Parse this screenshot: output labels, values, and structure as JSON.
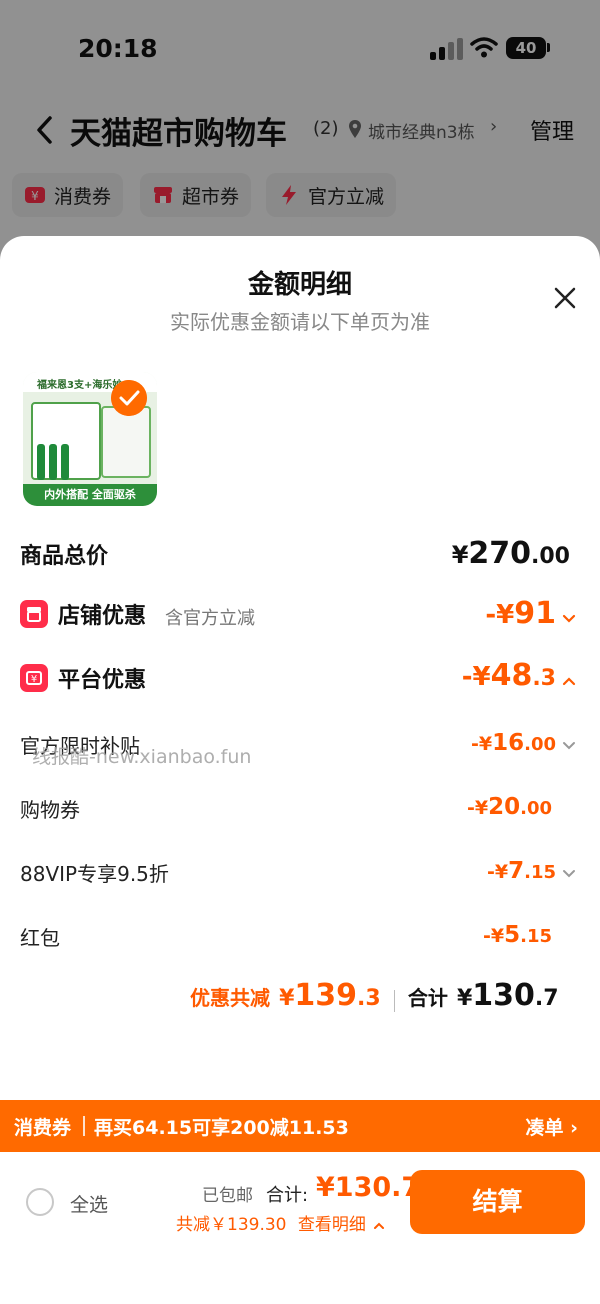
{
  "status_bar": {
    "time": "20:18",
    "battery": "40"
  },
  "header": {
    "title": "天猫超市购物车",
    "count": "(2)",
    "location": "城市经典n3栋",
    "location_arrow": "›",
    "manage": "管理"
  },
  "chips": [
    {
      "label": "消费券",
      "icon": "coupon-icon"
    },
    {
      "label": "超市券",
      "icon": "shop-icon"
    },
    {
      "label": "官方立减",
      "icon": "bolt-icon"
    }
  ],
  "sheet": {
    "title": "金额明细",
    "subtitle": "实际优惠金额请以下单页为准"
  },
  "product": {
    "top_text": "福来恩3支+海乐妙",
    "banner": "内外搭配 全面驱杀",
    "selected": true
  },
  "price_rows": {
    "total": {
      "label": "商品总价",
      "yen": "¥",
      "int": "270",
      "dec": ".00"
    },
    "store": {
      "label": "店铺优惠",
      "note": "含官方立减",
      "prefix": "-¥",
      "int": "91",
      "dec": ""
    },
    "platform": {
      "label": "平台优惠",
      "prefix": "-¥",
      "int": "48",
      "dec": ".3"
    },
    "subsidy": {
      "label": "官方限时补贴",
      "prefix": "-¥",
      "int": "16",
      "dec": ".00"
    },
    "coupon": {
      "label": "购物券",
      "prefix": "-¥",
      "int": "20",
      "dec": ".00"
    },
    "vip": {
      "label": "88VIP专享9.5折",
      "prefix": "-¥",
      "int": "7",
      "dec": ".15"
    },
    "redpacket": {
      "label": "红包",
      "prefix": "-¥",
      "int": "5",
      "dec": ".15"
    }
  },
  "summary": {
    "discount_label": "优惠共减",
    "discount_yen": "¥",
    "discount_int": "139",
    "discount_dec": ".3",
    "total_label": "合计",
    "total_yen": "¥",
    "total_int": "130",
    "total_dec": ".7"
  },
  "watermark": "线报酷-new.xianbao.fun",
  "coupon_bar": {
    "tag": "消费券",
    "text": "再买64.15可享200减11.53",
    "link": "凑单 ›"
  },
  "checkout": {
    "select_all": "全选",
    "shipping": "已包邮",
    "total_label": "合计:",
    "total_value": "¥130.7",
    "savings": "共减￥139.30",
    "details": "查看明细",
    "pay": "结算"
  },
  "colors": {
    "accent": "#ff6a00",
    "discount": "#ff5a00",
    "badge": "#ff2d4a"
  }
}
